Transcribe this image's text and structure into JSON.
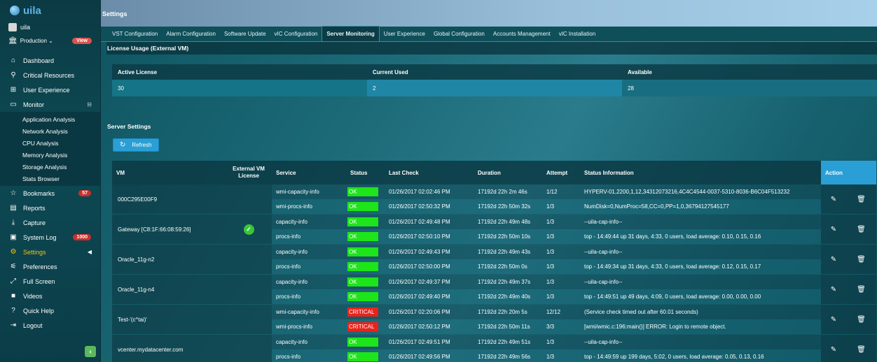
{
  "app": {
    "logo_text": "uila"
  },
  "user": {
    "name": "uila"
  },
  "environment": {
    "label": "Production ⌄",
    "view_badge": "View"
  },
  "nav": {
    "dashboard": "Dashboard",
    "critical_resources": "Critical Resources",
    "user_experience": "User Experience",
    "monitor": "Monitor",
    "monitor_sub": [
      "Application Analysis",
      "Network Analysis",
      "CPU Analysis",
      "Memory Analysis",
      "Storage Analysis",
      "Stats Browser"
    ],
    "bookmarks": "Bookmarks",
    "bookmarks_count": "57",
    "reports": "Reports",
    "capture": "Capture",
    "system_log": "System Log",
    "system_log_count": "1000",
    "settings": "Settings",
    "preferences": "Preferences",
    "full_screen": "Full Screen",
    "videos": "Videos",
    "quick_help": "Quick Help",
    "logout": "Logout"
  },
  "page": {
    "title": "Settings"
  },
  "tabs": [
    "VST Configuration",
    "Alarm Configuration",
    "Software Update",
    "vIC Configuration",
    "Server Monitoring",
    "User Experience",
    "Global Configuration",
    "Accounts Management",
    "vIC Installation"
  ],
  "license": {
    "section_title": "License Usage (External VM)",
    "headers": [
      "Active License",
      "Current Used",
      "Available"
    ],
    "values": [
      "30",
      "2",
      "28"
    ]
  },
  "server_settings": {
    "section_title": "Server Settings",
    "refresh_label": "Refresh",
    "headers": {
      "vm": "VM",
      "external": "External VM License",
      "service": "Service",
      "status": "Status",
      "last_check": "Last Check",
      "duration": "Duration",
      "attempt": "Attempt",
      "status_info": "Status Information",
      "action": "Action"
    },
    "groups": [
      {
        "vm": "000C295E00F9",
        "external": false,
        "rows": [
          {
            "service": "wmi-capacity-info",
            "status": "OK",
            "last_check": "01/26/2017 02:02:46 PM",
            "duration": "17192d 22h 2m 46s",
            "attempt": "1/12",
            "info": "HYPERV-01,2200,1,12,34312073216,4C4C4544-0037-5310-8036-B6C04F513232"
          },
          {
            "service": "wmi-procs-info",
            "status": "OK",
            "last_check": "01/26/2017 02:50:32 PM",
            "duration": "17192d 22h 50m 32s",
            "attempt": "1/3",
            "info": "NumDisk=0,NumProc=58,CC=0,PP=1,0,36794127545177"
          }
        ]
      },
      {
        "vm": "Gateway [C8:1F:66:08:59:26]",
        "external": true,
        "rows": [
          {
            "service": "capacity-info",
            "status": "OK",
            "last_check": "01/26/2017 02:49:48 PM",
            "duration": "17192d 22h 49m 48s",
            "attempt": "1/3",
            "info": "--uila-cap-info--"
          },
          {
            "service": "procs-info",
            "status": "OK",
            "last_check": "01/26/2017 02:50:10 PM",
            "duration": "17192d 22h 50m 10s",
            "attempt": "1/3",
            "info": "top - 14:49:44 up 31 days, 4:33, 0 users, load average: 0.10, 0.15, 0.16"
          }
        ]
      },
      {
        "vm": "Oracle_11g-n2",
        "external": false,
        "rows": [
          {
            "service": "capacity-info",
            "status": "OK",
            "last_check": "01/26/2017 02:49:43 PM",
            "duration": "17192d 22h 49m 43s",
            "attempt": "1/3",
            "info": "--uila-cap-info--"
          },
          {
            "service": "procs-info",
            "status": "OK",
            "last_check": "01/26/2017 02:50:00 PM",
            "duration": "17192d 22h 50m 0s",
            "attempt": "1/3",
            "info": "top - 14:49:34 up 31 days, 4:33, 0 users, load average: 0.12, 0.15, 0.17"
          }
        ]
      },
      {
        "vm": "Oracle_11g-n4",
        "external": false,
        "rows": [
          {
            "service": "capacity-info",
            "status": "OK",
            "last_check": "01/26/2017 02:49:37 PM",
            "duration": "17192d 22h 49m 37s",
            "attempt": "1/3",
            "info": "--uila-cap-info--"
          },
          {
            "service": "procs-info",
            "status": "OK",
            "last_check": "01/26/2017 02:49:40 PM",
            "duration": "17192d 22h 49m 40s",
            "attempt": "1/3",
            "info": "top - 14:49:51 up 49 days, 4:09, 0 users, load average: 0.00, 0.00, 0.00"
          }
        ]
      },
      {
        "vm": "Test-'(c^tai)'",
        "external": false,
        "rows": [
          {
            "service": "wmi-capacity-info",
            "status": "CRITICAL",
            "last_check": "01/26/2017 02:20:06 PM",
            "duration": "17192d 22h 20m 5s",
            "attempt": "12/12",
            "info": "(Service check timed out after 60.01 seconds)"
          },
          {
            "service": "wmi-procs-info",
            "status": "CRITICAL",
            "last_check": "01/26/2017 02:50:12 PM",
            "duration": "17192d 22h 50m 11s",
            "attempt": "3/3",
            "info": "[wmi/wmic.c:196:main()] ERROR: Login to remote object."
          }
        ]
      },
      {
        "vm": "vcenter.mydatacenter.com",
        "external": false,
        "rows": [
          {
            "service": "capacity-info",
            "status": "OK",
            "last_check": "01/26/2017 02:49:51 PM",
            "duration": "17192d 22h 49m 51s",
            "attempt": "1/3",
            "info": "--uila-cap-info--"
          },
          {
            "service": "procs-info",
            "status": "OK",
            "last_check": "01/26/2017 02:49:56 PM",
            "duration": "17192d 22h 49m 56s",
            "attempt": "1/3",
            "info": "top - 14:49:59 up 199 days, 5:02, 0 users, load average: 0.05, 0.13, 0.16"
          }
        ]
      }
    ]
  },
  "colors": {
    "accent": "#2a9fd6",
    "ok": "#1ee41a",
    "critical": "#e8231c",
    "active_nav": "#f3c316"
  }
}
